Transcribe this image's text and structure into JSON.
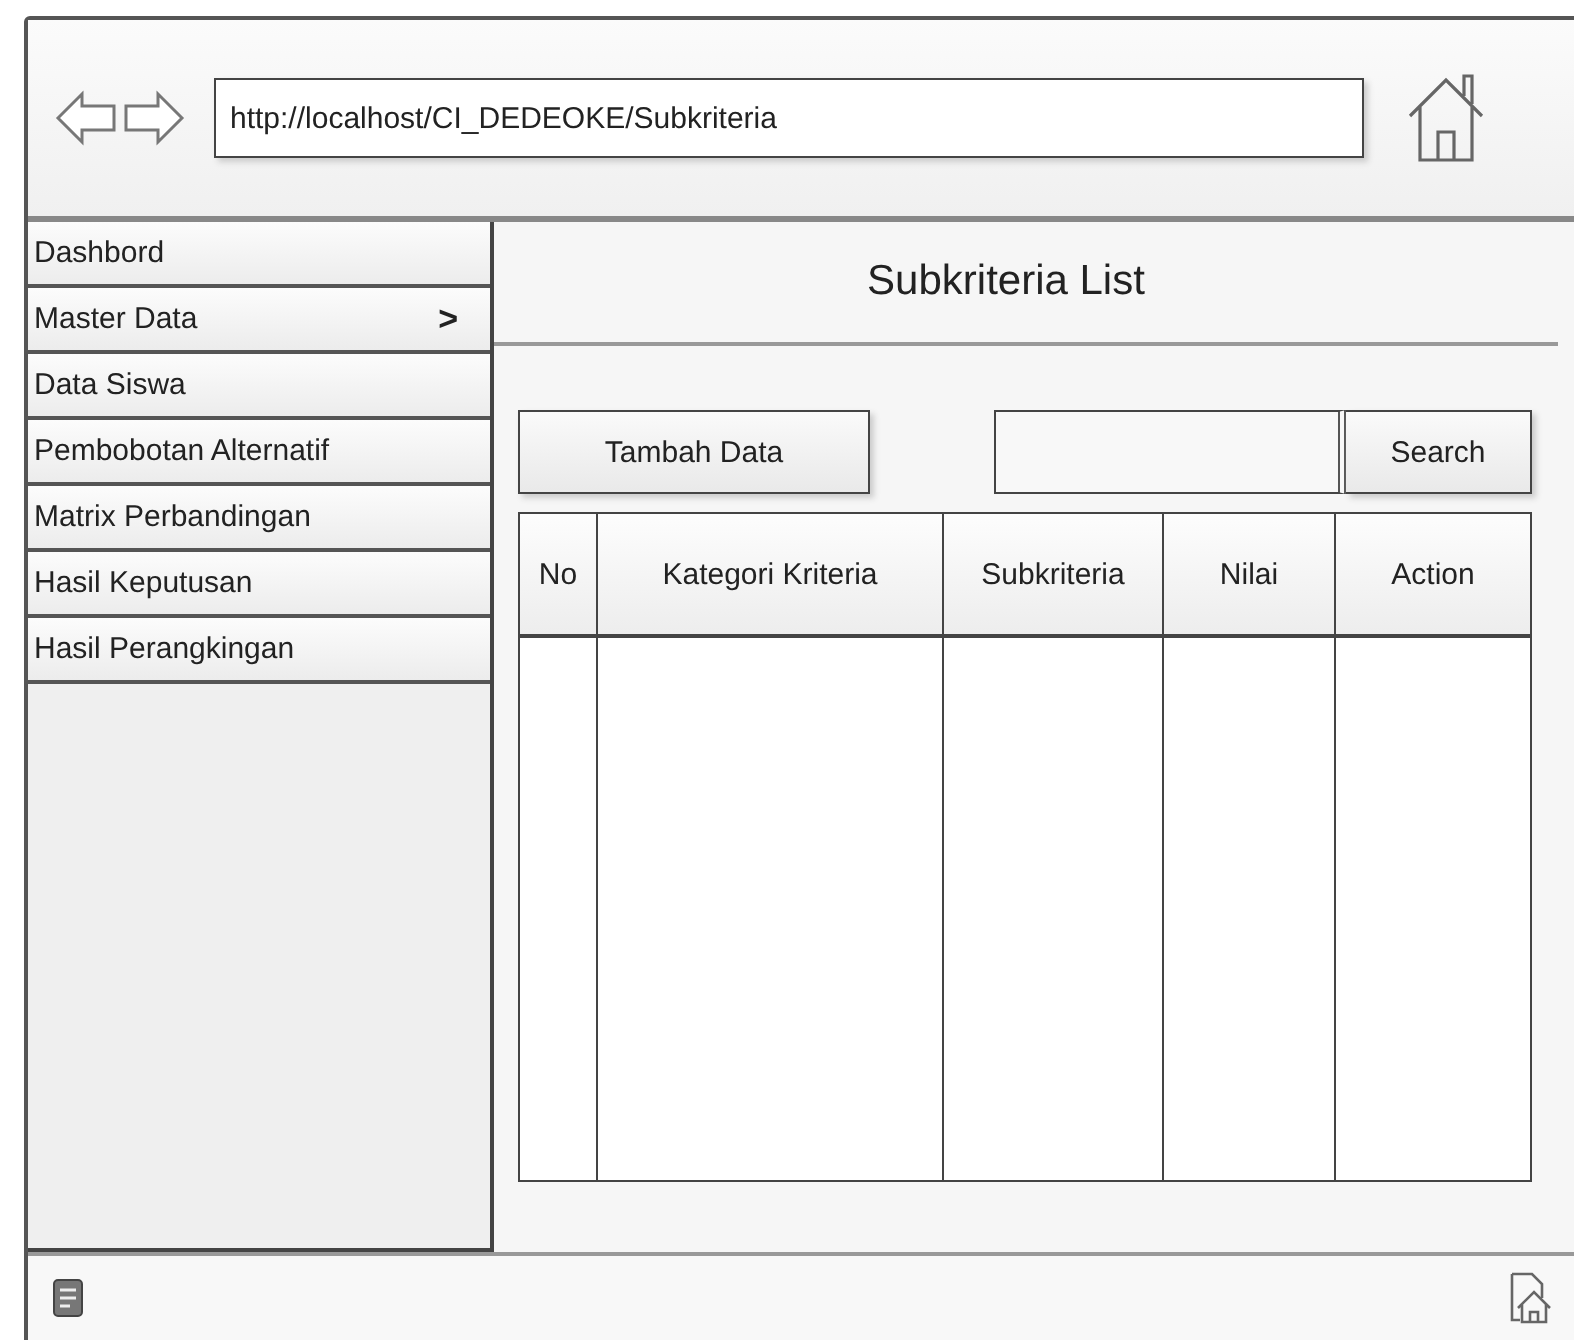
{
  "browser": {
    "url": "http://localhost/CI_DEDEOKE/Subkriteria"
  },
  "sidebar": {
    "items": [
      {
        "label": "Dashbord"
      },
      {
        "label": "Master Data",
        "arrow": ">"
      },
      {
        "label": "Data Siswa"
      },
      {
        "label": "Pembobotan Alternatif"
      },
      {
        "label": "Matrix Perbandingan"
      },
      {
        "label": "Hasil Keputusan"
      },
      {
        "label": "Hasil Perangkingan"
      }
    ]
  },
  "page_title": "Subkriteria List",
  "add_button": "Tambah Data",
  "search_button": "Search",
  "table": {
    "columns": [
      "No",
      "Kategori Kriteria",
      "Subkriteria",
      "Nilai",
      "Action"
    ]
  }
}
